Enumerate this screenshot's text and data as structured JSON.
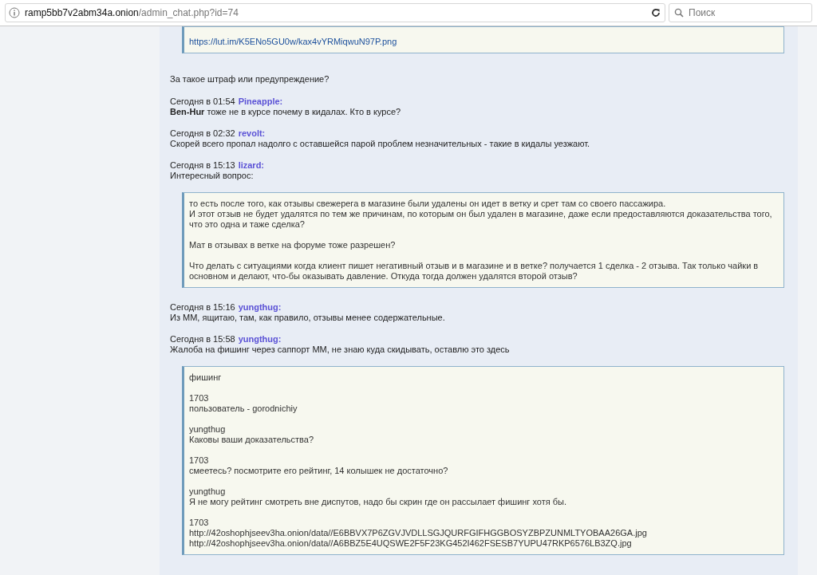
{
  "browser": {
    "url_host": "ramp5bb7v2abm34a.onion",
    "url_path": "/admin_chat.php?id=74",
    "search_placeholder": "Поиск"
  },
  "items": [
    {
      "kind": "link_quote",
      "paragraphs": [
        [
          "https://lut.im/K5ENo5GU0w/kax4vYRMiqwuN97P.png"
        ]
      ]
    },
    {
      "kind": "text",
      "text": "За такое штраф или предупреждение?"
    },
    {
      "kind": "post",
      "time": "Сегодня в 01:54",
      "author": "Pineapple:",
      "body": "**Ben-Hur** тоже не в курсе почему в кидалах. Кто в курсе?"
    },
    {
      "kind": "post",
      "time": "Сегодня в 02:32",
      "author": "revolt:",
      "body": "Скорей всего пропал надолго с оставшейся парой проблем незначительных - такие в кидалы уезжают."
    },
    {
      "kind": "post",
      "time": "Сегодня в 15:13",
      "author": "lizard:",
      "body": "Интересный вопрос:"
    },
    {
      "kind": "quote",
      "paragraphs": [
        [
          "то есть после того, как отзывы свежерега в магазине были удалены он идет в ветку и срет там со своего пассажира.",
          "И этот отзыв не будет удалятся по тем же причинам, по которым он был удален в магазине, даже если предоставляются доказательства того, что это одна и таже сделка?"
        ],
        [
          "Мат в отзывах в ветке на форуме тоже разрешен?"
        ],
        [
          "Что делать с ситуациями когда клиент пишет негативный отзыв и в магазине и в ветке? получается 1 сделка - 2 отзыва. Так только чайки в основном и делают, что-бы оказывать давление. Откуда тогда должен удалятся второй отзыв?"
        ]
      ]
    },
    {
      "kind": "post",
      "time": "Сегодня в 15:16",
      "author": "yungthug:",
      "body": "Из ММ, ящитаю, там, как правило, отзывы менее содержательные."
    },
    {
      "kind": "post",
      "time": "Сегодня в 15:58",
      "author": "yungthug:",
      "body": "Жалоба на фишинг через саппорт ММ, не знаю куда скидывать, оставлю это здесь"
    },
    {
      "kind": "quote",
      "paragraphs": [
        [
          "фишинг"
        ],
        [
          "1703",
          "пользователь - gorodnichiy"
        ],
        [
          "yungthug",
          "Каковы ваши доказательства?"
        ],
        [
          "1703",
          "смеетесь? посмотрите его рейтинг, 14 колышек не достаточно?"
        ],
        [
          "yungthug",
          "Я не могу рейтинг смотреть вне диспутов, надо бы скрин где он рассылает фишинг хотя бы."
        ],
        [
          "1703",
          "http://42oshophjseev3ha.onion/data//E6BBVX7P6ZGVJVDLLSGJQURFGIFHGGBOSYZBPZUNMLTYOBAA26GA.jpg",
          "http://42oshophjseev3ha.onion/data//A6BBZ5E4UQSWE2F5F23KG452I462FSESB7YUPU47RKP6576LB3ZQ.jpg"
        ]
      ]
    }
  ]
}
